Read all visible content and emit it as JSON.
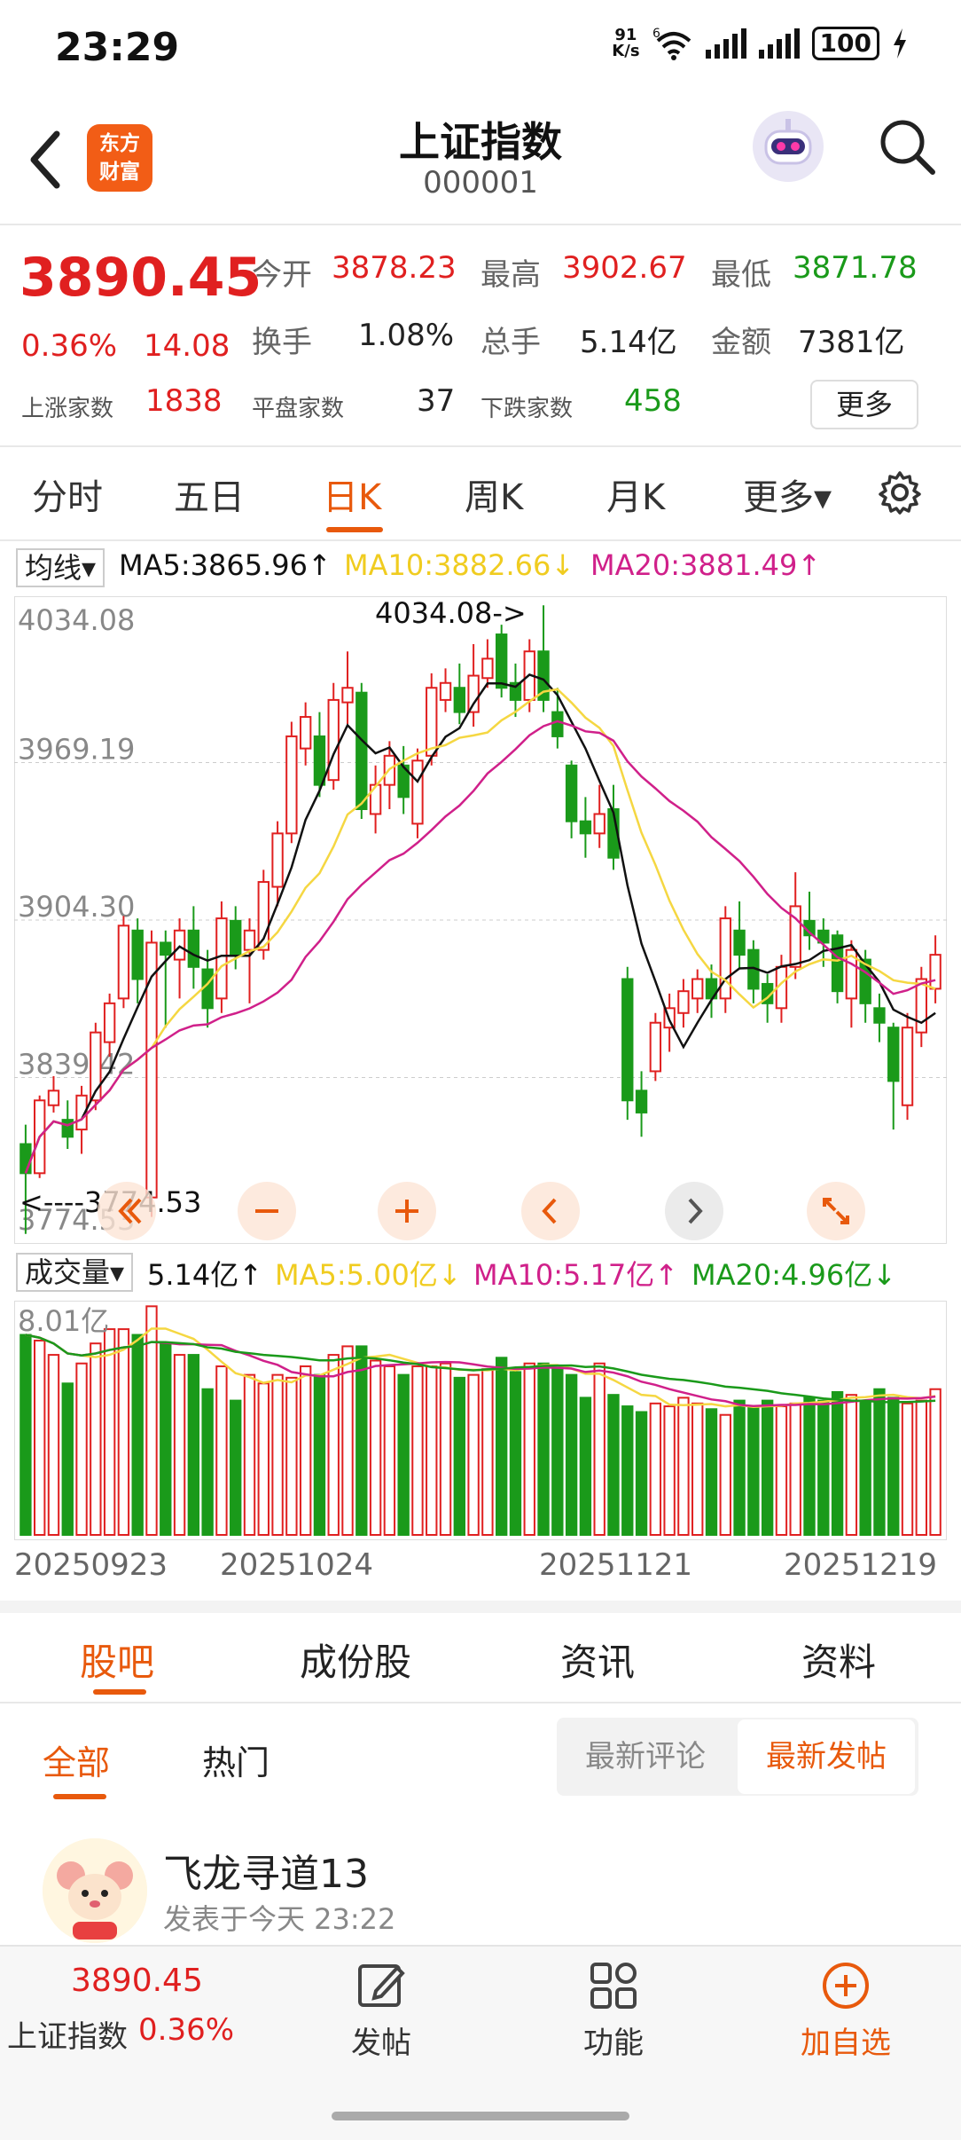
{
  "status": {
    "time": "23:29",
    "net_speed_top": "91",
    "net_speed_unit": "K/s",
    "wifi_tag": "6",
    "battery": "100"
  },
  "header": {
    "logo_line1": "东方",
    "logo_line2": "财富",
    "title": "上证指数",
    "code": "000001"
  },
  "quote": {
    "price": "3890.45",
    "change_pct": "0.36%",
    "change_abs": "14.08",
    "open_label": "今开",
    "open": "3878.23",
    "high_label": "最高",
    "high": "3902.67",
    "low_label": "最低",
    "low": "3871.78",
    "turnover_label": "换手",
    "turnover": "1.08%",
    "volume_label": "总手",
    "volume": "5.14亿",
    "amount_label": "金额",
    "amount": "7381亿",
    "up_label": "上涨家数",
    "up_count": "1838",
    "flat_label": "平盘家数",
    "flat_count": "37",
    "down_label": "下跌家数",
    "down_count": "458",
    "more_label": "更多"
  },
  "tabs": [
    "分时",
    "五日",
    "日K",
    "周K",
    "月K",
    "更多▾"
  ],
  "kline": {
    "legend_label": "均线",
    "ma5": "MA5:3865.96↑",
    "ma10": "MA10:3882.66↓",
    "ma20": "MA20:3881.49↑",
    "y_labels": [
      "4034.08",
      "3969.19",
      "3904.30",
      "3839.42",
      "3774.53"
    ],
    "max_label": "4034.08->",
    "min_label": "<----3774.53"
  },
  "volume_panel": {
    "legend_label": "成交量",
    "vol": "5.14亿↑",
    "ma5": "MA5:5.00亿↓",
    "ma10": "MA10:5.17亿↑",
    "ma20": "MA20:4.96亿↓",
    "max_label": "8.01亿",
    "dates": [
      "20250923",
      "20251024",
      "20251121",
      "20251219"
    ]
  },
  "colors": {
    "up": "#e02020",
    "down": "#1a9a1a",
    "accent": "#e8590c",
    "ma5": "#111111",
    "ma10": "#f5d742",
    "ma20": "#d0208a",
    "vma20": "#1a9a1a"
  },
  "chart_data": {
    "type": "candlestick",
    "ylim": [
      3774.53,
      4034.08
    ],
    "candles": [
      [
        3812,
        3800,
        3820,
        3775
      ],
      [
        3800,
        3830,
        3832,
        3798
      ],
      [
        3828,
        3834,
        3840,
        3825
      ],
      [
        3822,
        3815,
        3830,
        3810
      ],
      [
        3818,
        3832,
        3836,
        3808
      ],
      [
        3830,
        3858,
        3862,
        3826
      ],
      [
        3854,
        3870,
        3874,
        3848
      ],
      [
        3872,
        3902,
        3906,
        3868
      ],
      [
        3900,
        3880,
        3905,
        3870
      ],
      [
        3790,
        3895,
        3900,
        3782
      ],
      [
        3895,
        3890,
        3900,
        3860
      ],
      [
        3888,
        3900,
        3905,
        3872
      ],
      [
        3900,
        3885,
        3910,
        3876
      ],
      [
        3884,
        3868,
        3892,
        3860
      ],
      [
        3872,
        3905,
        3912,
        3866
      ],
      [
        3904,
        3890,
        3910,
        3884
      ],
      [
        3892,
        3900,
        3905,
        3870
      ],
      [
        3892,
        3920,
        3925,
        3888
      ],
      [
        3918,
        3940,
        3945,
        3910
      ],
      [
        3940,
        3980,
        3986,
        3936
      ],
      [
        3975,
        3988,
        3994,
        3968
      ],
      [
        3980,
        3960,
        3990,
        3955
      ],
      [
        3962,
        3995,
        4002,
        3958
      ],
      [
        3994,
        4000,
        4015,
        3985
      ],
      [
        3998,
        3950,
        4002,
        3946
      ],
      [
        3948,
        3960,
        3968,
        3940
      ],
      [
        3960,
        3972,
        3978,
        3950
      ],
      [
        3968,
        3955,
        3976,
        3948
      ],
      [
        3944,
        3970,
        3975,
        3938
      ],
      [
        3972,
        4000,
        4006,
        3968
      ],
      [
        3995,
        4002,
        4008,
        3990
      ],
      [
        4000,
        3990,
        4010,
        3985
      ],
      [
        3990,
        4005,
        4018,
        3984
      ],
      [
        4004,
        4012,
        4020,
        4000
      ],
      [
        4022,
        4000,
        4026,
        3996
      ],
      [
        4002,
        3995,
        4010,
        3988
      ],
      [
        3995,
        4015,
        4020,
        3990
      ],
      [
        4015,
        3995,
        4034,
        3990
      ],
      [
        3990,
        3980,
        4000,
        3975
      ],
      [
        3968,
        3945,
        3970,
        3938
      ],
      [
        3945,
        3940,
        3955,
        3930
      ],
      [
        3940,
        3948,
        3960,
        3934
      ],
      [
        3950,
        3930,
        3960,
        3925
      ],
      [
        3880,
        3830,
        3885,
        3822
      ],
      [
        3834,
        3825,
        3842,
        3815
      ],
      [
        3842,
        3862,
        3866,
        3838
      ],
      [
        3860,
        3868,
        3874,
        3850
      ],
      [
        3866,
        3875,
        3880,
        3860
      ],
      [
        3872,
        3880,
        3884,
        3866
      ],
      [
        3880,
        3872,
        3886,
        3864
      ],
      [
        3872,
        3905,
        3910,
        3866
      ],
      [
        3900,
        3890,
        3912,
        3884
      ],
      [
        3892,
        3876,
        3896,
        3870
      ],
      [
        3878,
        3870,
        3882,
        3862
      ],
      [
        3868,
        3885,
        3890,
        3862
      ],
      [
        3885,
        3910,
        3924,
        3880
      ],
      [
        3904,
        3898,
        3916,
        3892
      ],
      [
        3900,
        3895,
        3905,
        3885
      ],
      [
        3898,
        3875,
        3900,
        3870
      ],
      [
        3872,
        3892,
        3896,
        3860
      ],
      [
        3888,
        3870,
        3892,
        3862
      ],
      [
        3868,
        3862,
        3874,
        3854
      ],
      [
        3860,
        3838,
        3862,
        3818
      ],
      [
        3828,
        3860,
        3866,
        3822
      ],
      [
        3858,
        3880,
        3885,
        3852
      ],
      [
        3876,
        3890,
        3898,
        3870
      ]
    ],
    "volumes": [
      7.0,
      6.8,
      6.3,
      5.3,
      6.0,
      6.7,
      7.2,
      7.2,
      7.0,
      8.0,
      6.7,
      6.3,
      6.3,
      5.1,
      5.9,
      4.7,
      5.6,
      5.3,
      5.6,
      5.5,
      5.9,
      5.6,
      6.3,
      6.6,
      6.6,
      6.1,
      5.9,
      5.6,
      5.9,
      5.9,
      6.0,
      5.5,
      5.6,
      5.8,
      6.2,
      5.7,
      6.0,
      6.0,
      5.8,
      5.6,
      4.8,
      6.0,
      4.9,
      4.5,
      4.3,
      4.6,
      4.5,
      4.8,
      4.6,
      4.4,
      4.2,
      4.7,
      4.5,
      4.7,
      4.5,
      4.6,
      4.8,
      4.7,
      5.0,
      4.9,
      4.7,
      5.1,
      4.8,
      4.6,
      4.7,
      5.1
    ]
  },
  "sections": [
    "股吧",
    "成份股",
    "资讯",
    "资料"
  ],
  "sub_tabs": {
    "all": "全部",
    "hot": "热门",
    "latest_comment": "最新评论",
    "latest_post": "最新发帖"
  },
  "post": {
    "user": "飞龙寻道13",
    "time": "发表于今天 23:22"
  },
  "bottom_nav": {
    "price": "3890.45",
    "name": "上证指数",
    "pct": "0.36%",
    "post": "发帖",
    "func": "功能",
    "add": "加自选"
  }
}
